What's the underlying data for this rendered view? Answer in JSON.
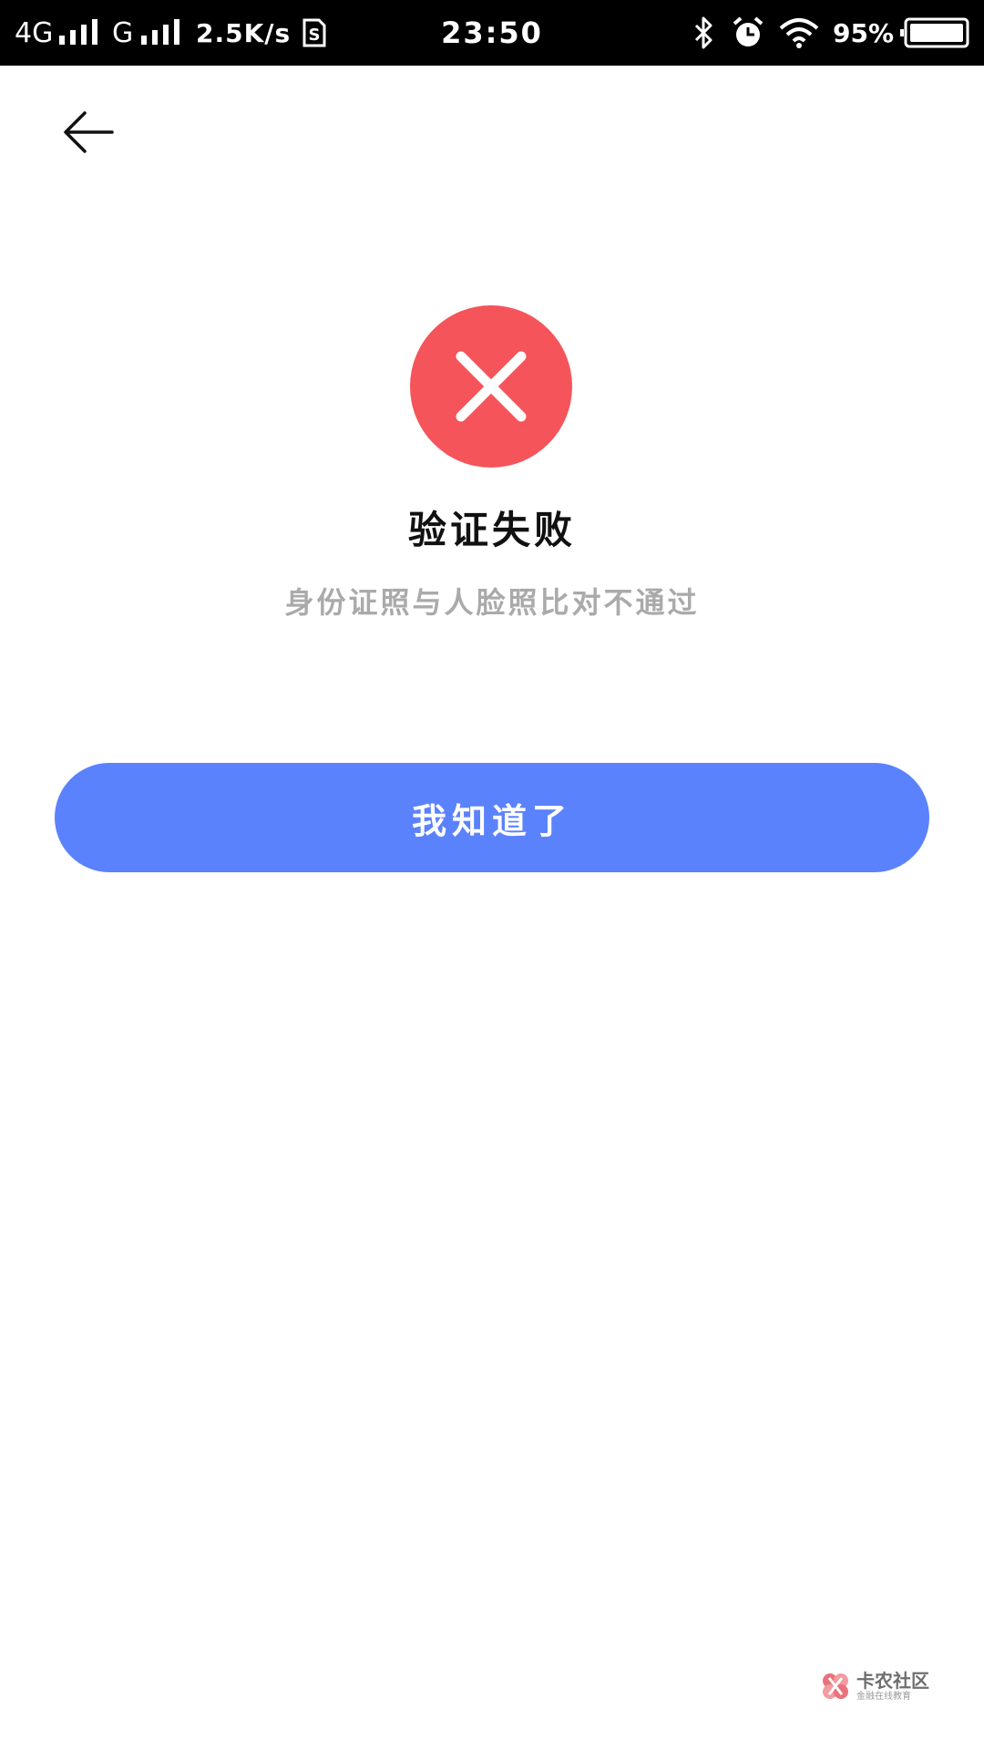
{
  "status_bar": {
    "network_1": "4G",
    "network_2": "G",
    "speed": "2.5K/s",
    "time": "23:50",
    "battery_percent": "95%"
  },
  "result": {
    "title": "验证失败",
    "message": "身份证照与人脸照比对不通过"
  },
  "action": {
    "confirm_label": "我知道了"
  },
  "colors": {
    "error_red": "#f5545a",
    "primary_blue": "#5b82fd"
  },
  "icons": {
    "back": "back-arrow-icon",
    "result": "error-x-icon"
  }
}
